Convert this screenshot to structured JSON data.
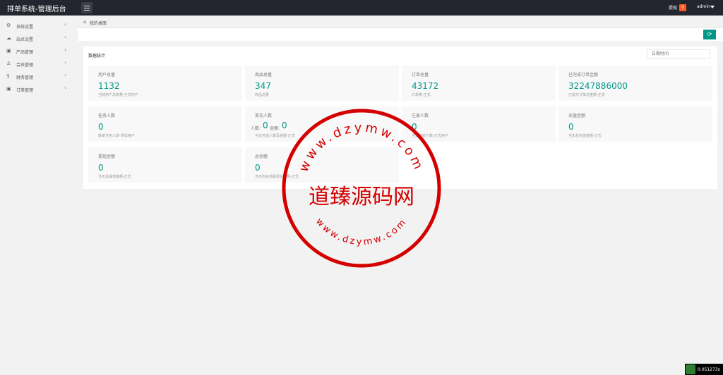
{
  "header": {
    "brand": "排单系统-管理后台",
    "withdraw_label": "提现",
    "withdraw_badge": "0",
    "user": "admin"
  },
  "sidebar": {
    "items": [
      {
        "label": "系统设置",
        "icon": "gear-icon"
      },
      {
        "label": "站点设置",
        "icon": "cloud-icon"
      },
      {
        "label": "产品管理",
        "icon": "box-icon"
      },
      {
        "label": "会员管理",
        "icon": "user-icon"
      },
      {
        "label": "财务管理",
        "icon": "dollar-icon"
      },
      {
        "label": "订单管理",
        "icon": "box-icon"
      }
    ]
  },
  "breadcrumb": {
    "current": "我的桌面"
  },
  "stats": {
    "title": "数据统计",
    "date_placeholder": "日期时间",
    "cards": [
      {
        "title": "用户总量",
        "value": "1132",
        "sub": "当前用户总数量-正式用户"
      },
      {
        "title": "商品总量",
        "value": "347",
        "sub": "商品总量"
      },
      {
        "title": "订单总量",
        "value": "43172",
        "sub": "订单量-正式"
      },
      {
        "title": "已完成订单金额",
        "value": "32247886000",
        "sub": "已提交订单总金额-正式"
      },
      {
        "title": "任务人数",
        "value": "0",
        "sub": "做单当天人数-测试用户"
      },
      {
        "title": "首充人数",
        "value": "",
        "sub": "当天充值人数及金额-正式",
        "mini": {
          "people_label": "人数:",
          "people_value": "0",
          "amount_label": "金额:",
          "amount_value": "0"
        }
      },
      {
        "title": "注册人数",
        "value": "0",
        "sub": "当天注册人数-正式用户"
      },
      {
        "title": "充值金额",
        "value": "0",
        "sub": "当天总充值金额-正式"
      },
      {
        "title": "提现金额",
        "value": "0",
        "sub": "当天总提现金额-正式"
      },
      {
        "title": "总余额",
        "value": "0",
        "sub": "当天的充值提现总余额-正式"
      }
    ]
  },
  "watermark": {
    "top_text": "www.dzymw.com",
    "center_text": "道臻源码网",
    "bottom_text": "www.dzymw.com",
    "color": "#d40000"
  },
  "timer": {
    "text": "0.051273s"
  }
}
